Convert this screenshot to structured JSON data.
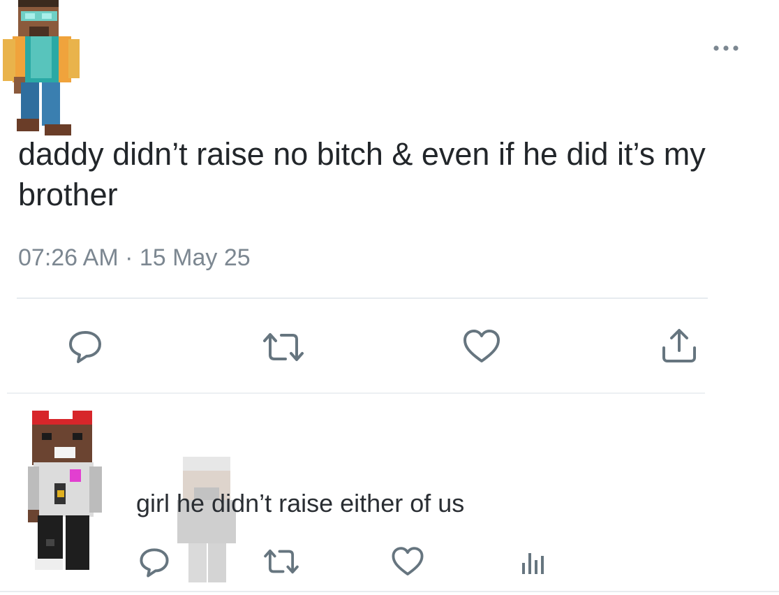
{
  "tweet": {
    "text": "daddy didn’t raise no bitch & even if he did it’s my brother",
    "time": "07:26 AM",
    "separator": "·",
    "date": "15 May 25"
  },
  "actions": {
    "reply_icon": "reply-icon",
    "retweet_icon": "retweet-icon",
    "like_icon": "heart-icon",
    "share_icon": "share-icon"
  },
  "reply": {
    "text": "girl he didn’t raise either of us",
    "icons": [
      "reply-icon",
      "retweet-icon",
      "heart-icon",
      "analytics-icon"
    ]
  },
  "colors": {
    "icon": "#66757f",
    "text": "#14171a",
    "meta": "#7c8791",
    "divider": "#e6ebef"
  }
}
